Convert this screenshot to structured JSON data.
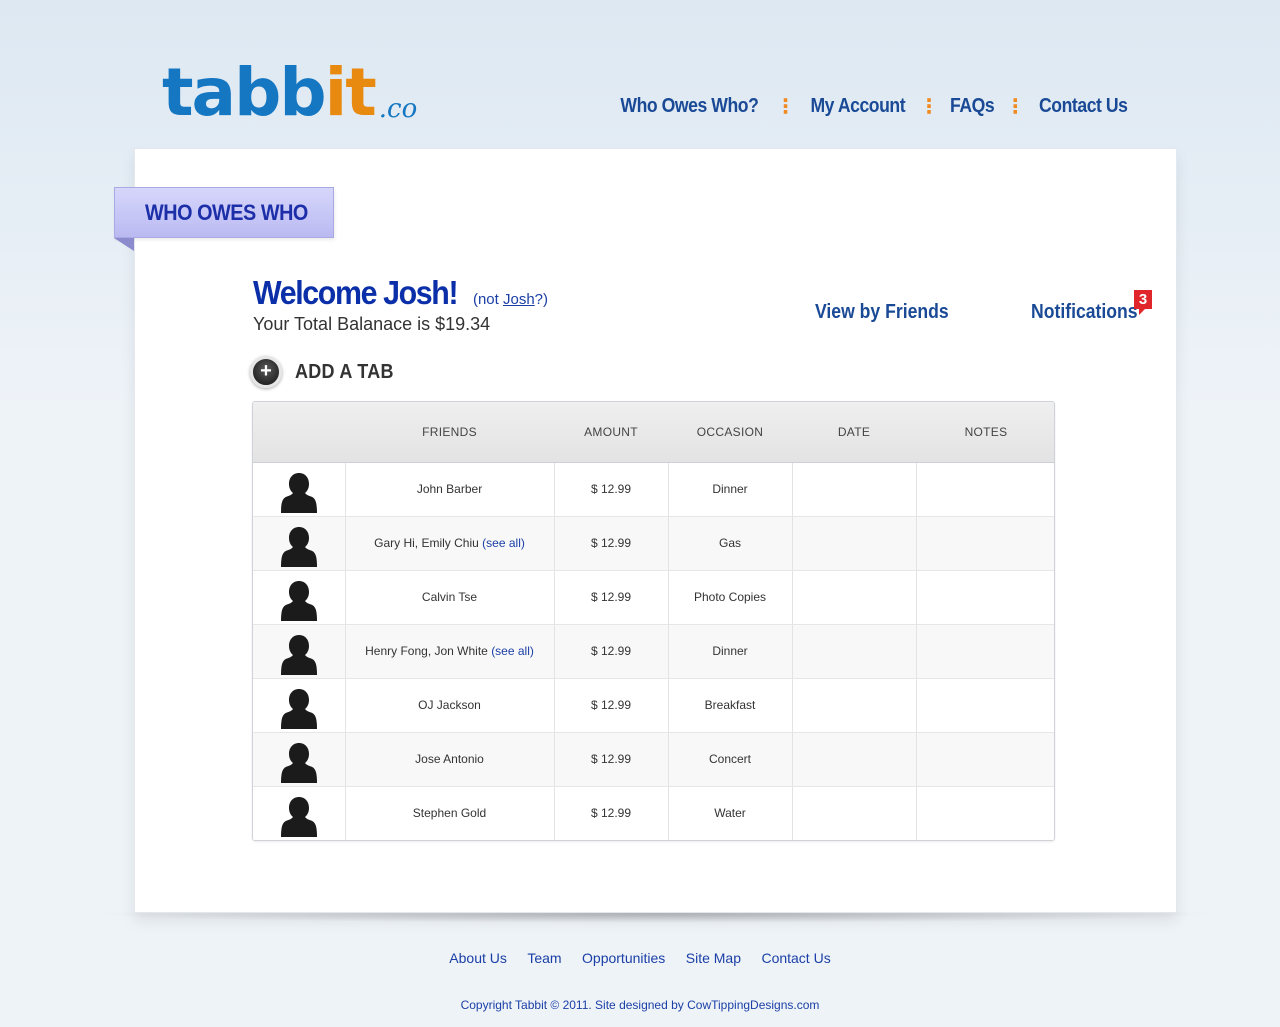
{
  "logo": {
    "part1": "tabb",
    "part2": "it",
    "suffix": ".co"
  },
  "topnav": {
    "items": [
      "Who Owes Who?",
      "My Account",
      "FAQs",
      "Contact Us"
    ],
    "separator": "⋮"
  },
  "ribbon": {
    "label": "WHO OWES WHO"
  },
  "welcome": {
    "title": "Welcome Josh!",
    "not_prefix": "(not ",
    "not_name": "Josh",
    "not_suffix": "?)",
    "balance": "Your Total Balanace is $19.34"
  },
  "actions": {
    "view_by_friends": "View by Friends",
    "notifications": "Notifications",
    "notifications_count": "3"
  },
  "add_tab": {
    "icon": "+",
    "label": "ADD A TAB"
  },
  "table": {
    "columns": [
      "",
      "FRIENDS",
      "AMOUNT",
      "OCCASION",
      "DATE",
      "NOTES"
    ],
    "see_all_label": "(see all)",
    "rows": [
      {
        "friends": "John Barber",
        "see_all": false,
        "amount": "$ 12.99",
        "occasion": "Dinner",
        "date": "",
        "notes": ""
      },
      {
        "friends": "Gary Hi, Emily Chiu",
        "see_all": true,
        "amount": "$ 12.99",
        "occasion": "Gas",
        "date": "",
        "notes": ""
      },
      {
        "friends": "Calvin Tse",
        "see_all": false,
        "amount": "$ 12.99",
        "occasion": "Photo Copies",
        "date": "",
        "notes": ""
      },
      {
        "friends": "Henry Fong, Jon White",
        "see_all": true,
        "amount": "$ 12.99",
        "occasion": "Dinner",
        "date": "",
        "notes": ""
      },
      {
        "friends": "OJ Jackson",
        "see_all": false,
        "amount": "$ 12.99",
        "occasion": "Breakfast",
        "date": "",
        "notes": ""
      },
      {
        "friends": "Jose Antonio",
        "see_all": false,
        "amount": "$ 12.99",
        "occasion": "Concert",
        "date": "",
        "notes": ""
      },
      {
        "friends": "Stephen Gold",
        "see_all": false,
        "amount": "$ 12.99",
        "occasion": "Water",
        "date": "",
        "notes": ""
      }
    ]
  },
  "footer": {
    "links": [
      "About Us",
      "Team",
      "Opportunities",
      "Site Map",
      "Contact Us"
    ],
    "copyright": "Copyright Tabbit © 2011. Site designed by CowTippingDesigns.com"
  },
  "colors": {
    "brand_blue": "#1577c2",
    "brand_orange": "#e98a10",
    "nav_blue": "#1a4a96",
    "badge_red": "#e0252b",
    "ribbon_purple": "#c8c8f7"
  }
}
